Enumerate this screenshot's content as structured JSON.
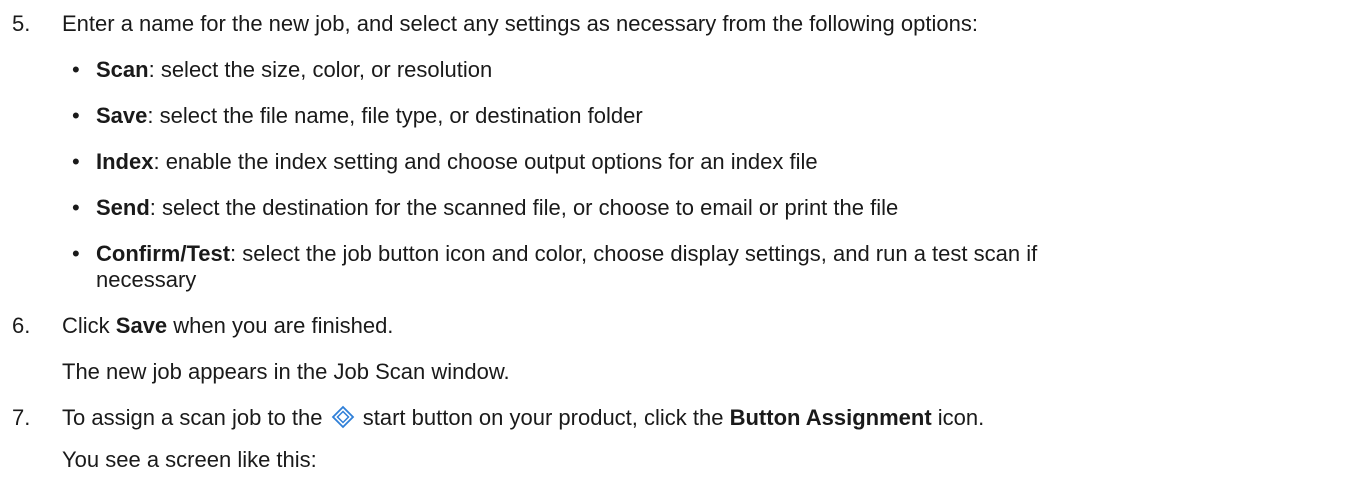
{
  "steps": [
    {
      "number": "5.",
      "text": "Enter a name for the new job, and select any settings as necessary from the following options:",
      "bullets": [
        {
          "term": "Scan",
          "desc": ": select the size, color, or resolution"
        },
        {
          "term": "Save",
          "desc": ": select the file name, file type, or destination folder"
        },
        {
          "term": "Index",
          "desc": ": enable the index setting and choose output options for an index file"
        },
        {
          "term": "Send",
          "desc": ": select the destination for the scanned file, or choose to email or print the file"
        },
        {
          "term": "Confirm/Test",
          "desc": ": select the job button icon and color, choose display settings, and run a test scan if",
          "desc_cont": "necessary"
        }
      ]
    },
    {
      "number": "6.",
      "pre": "Click ",
      "bold": "Save",
      "post": " when you are finished.",
      "note": "The new job appears in the Job Scan window."
    },
    {
      "number": "7.",
      "pre": "To assign a scan job to the",
      "icon": "start-diamond-icon",
      "mid": "start button on your product, click the ",
      "bold": "Button Assignment",
      "post": " icon.",
      "note": "You see a screen like this:"
    }
  ],
  "colors": {
    "text": "#1a1a1a",
    "icon": "#2f7fd8"
  }
}
